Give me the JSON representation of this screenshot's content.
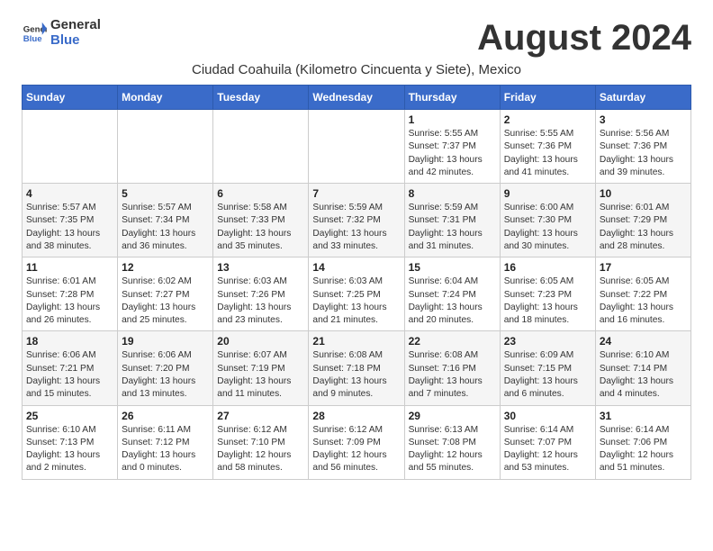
{
  "logo": {
    "general": "General",
    "blue": "Blue"
  },
  "month_title": "August 2024",
  "location": "Ciudad Coahuila (Kilometro Cincuenta y Siete), Mexico",
  "days_of_week": [
    "Sunday",
    "Monday",
    "Tuesday",
    "Wednesday",
    "Thursday",
    "Friday",
    "Saturday"
  ],
  "weeks": [
    [
      {
        "day": "",
        "info": ""
      },
      {
        "day": "",
        "info": ""
      },
      {
        "day": "",
        "info": ""
      },
      {
        "day": "",
        "info": ""
      },
      {
        "day": "1",
        "info": "Sunrise: 5:55 AM\nSunset: 7:37 PM\nDaylight: 13 hours\nand 42 minutes."
      },
      {
        "day": "2",
        "info": "Sunrise: 5:55 AM\nSunset: 7:36 PM\nDaylight: 13 hours\nand 41 minutes."
      },
      {
        "day": "3",
        "info": "Sunrise: 5:56 AM\nSunset: 7:36 PM\nDaylight: 13 hours\nand 39 minutes."
      }
    ],
    [
      {
        "day": "4",
        "info": "Sunrise: 5:57 AM\nSunset: 7:35 PM\nDaylight: 13 hours\nand 38 minutes."
      },
      {
        "day": "5",
        "info": "Sunrise: 5:57 AM\nSunset: 7:34 PM\nDaylight: 13 hours\nand 36 minutes."
      },
      {
        "day": "6",
        "info": "Sunrise: 5:58 AM\nSunset: 7:33 PM\nDaylight: 13 hours\nand 35 minutes."
      },
      {
        "day": "7",
        "info": "Sunrise: 5:59 AM\nSunset: 7:32 PM\nDaylight: 13 hours\nand 33 minutes."
      },
      {
        "day": "8",
        "info": "Sunrise: 5:59 AM\nSunset: 7:31 PM\nDaylight: 13 hours\nand 31 minutes."
      },
      {
        "day": "9",
        "info": "Sunrise: 6:00 AM\nSunset: 7:30 PM\nDaylight: 13 hours\nand 30 minutes."
      },
      {
        "day": "10",
        "info": "Sunrise: 6:01 AM\nSunset: 7:29 PM\nDaylight: 13 hours\nand 28 minutes."
      }
    ],
    [
      {
        "day": "11",
        "info": "Sunrise: 6:01 AM\nSunset: 7:28 PM\nDaylight: 13 hours\nand 26 minutes."
      },
      {
        "day": "12",
        "info": "Sunrise: 6:02 AM\nSunset: 7:27 PM\nDaylight: 13 hours\nand 25 minutes."
      },
      {
        "day": "13",
        "info": "Sunrise: 6:03 AM\nSunset: 7:26 PM\nDaylight: 13 hours\nand 23 minutes."
      },
      {
        "day": "14",
        "info": "Sunrise: 6:03 AM\nSunset: 7:25 PM\nDaylight: 13 hours\nand 21 minutes."
      },
      {
        "day": "15",
        "info": "Sunrise: 6:04 AM\nSunset: 7:24 PM\nDaylight: 13 hours\nand 20 minutes."
      },
      {
        "day": "16",
        "info": "Sunrise: 6:05 AM\nSunset: 7:23 PM\nDaylight: 13 hours\nand 18 minutes."
      },
      {
        "day": "17",
        "info": "Sunrise: 6:05 AM\nSunset: 7:22 PM\nDaylight: 13 hours\nand 16 minutes."
      }
    ],
    [
      {
        "day": "18",
        "info": "Sunrise: 6:06 AM\nSunset: 7:21 PM\nDaylight: 13 hours\nand 15 minutes."
      },
      {
        "day": "19",
        "info": "Sunrise: 6:06 AM\nSunset: 7:20 PM\nDaylight: 13 hours\nand 13 minutes."
      },
      {
        "day": "20",
        "info": "Sunrise: 6:07 AM\nSunset: 7:19 PM\nDaylight: 13 hours\nand 11 minutes."
      },
      {
        "day": "21",
        "info": "Sunrise: 6:08 AM\nSunset: 7:18 PM\nDaylight: 13 hours\nand 9 minutes."
      },
      {
        "day": "22",
        "info": "Sunrise: 6:08 AM\nSunset: 7:16 PM\nDaylight: 13 hours\nand 7 minutes."
      },
      {
        "day": "23",
        "info": "Sunrise: 6:09 AM\nSunset: 7:15 PM\nDaylight: 13 hours\nand 6 minutes."
      },
      {
        "day": "24",
        "info": "Sunrise: 6:10 AM\nSunset: 7:14 PM\nDaylight: 13 hours\nand 4 minutes."
      }
    ],
    [
      {
        "day": "25",
        "info": "Sunrise: 6:10 AM\nSunset: 7:13 PM\nDaylight: 13 hours\nand 2 minutes."
      },
      {
        "day": "26",
        "info": "Sunrise: 6:11 AM\nSunset: 7:12 PM\nDaylight: 13 hours\nand 0 minutes."
      },
      {
        "day": "27",
        "info": "Sunrise: 6:12 AM\nSunset: 7:10 PM\nDaylight: 12 hours\nand 58 minutes."
      },
      {
        "day": "28",
        "info": "Sunrise: 6:12 AM\nSunset: 7:09 PM\nDaylight: 12 hours\nand 56 minutes."
      },
      {
        "day": "29",
        "info": "Sunrise: 6:13 AM\nSunset: 7:08 PM\nDaylight: 12 hours\nand 55 minutes."
      },
      {
        "day": "30",
        "info": "Sunrise: 6:14 AM\nSunset: 7:07 PM\nDaylight: 12 hours\nand 53 minutes."
      },
      {
        "day": "31",
        "info": "Sunrise: 6:14 AM\nSunset: 7:06 PM\nDaylight: 12 hours\nand 51 minutes."
      }
    ]
  ]
}
